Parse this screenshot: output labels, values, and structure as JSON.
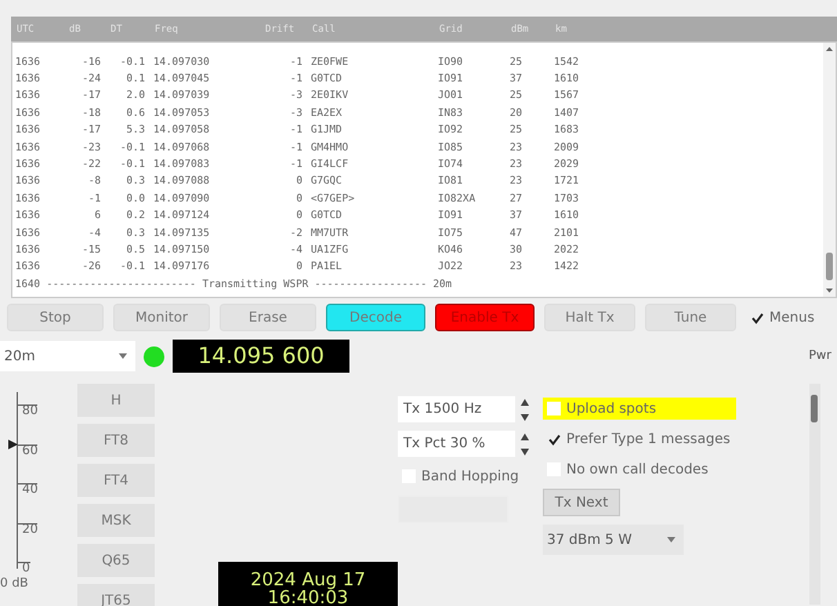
{
  "decodes": {
    "columns": [
      "UTC",
      "dB",
      "DT",
      "Freq",
      "Drift",
      "Call",
      "Grid",
      "dBm",
      "km"
    ],
    "rows": [
      [
        "1636",
        "-16",
        "-0.1",
        "14.097030",
        "-1",
        "ZE0FWE",
        "IO90",
        "25",
        "1542"
      ],
      [
        "1636",
        "-24",
        "0.1",
        "14.097045",
        "-1",
        "G0TCD",
        "IO91",
        "37",
        "1610"
      ],
      [
        "1636",
        "-17",
        "2.0",
        "14.097039",
        "-3",
        "2E0IKV",
        "JO01",
        "25",
        "1567"
      ],
      [
        "1636",
        "-18",
        "0.6",
        "14.097053",
        "-3",
        "EA2EX",
        "IN83",
        "20",
        "1407"
      ],
      [
        "1636",
        "-17",
        "5.3",
        "14.097058",
        "-1",
        "G1JMD",
        "IO92",
        "25",
        "1683"
      ],
      [
        "1636",
        "-23",
        "-0.1",
        "14.097068",
        "-1",
        "GM4HMO",
        "IO85",
        "23",
        "2009"
      ],
      [
        "1636",
        "-22",
        "-0.1",
        "14.097083",
        "-1",
        "GI4LCF",
        "IO74",
        "23",
        "2029"
      ],
      [
        "1636",
        "-8",
        "0.3",
        "14.097088",
        "0",
        "G7GQC",
        "IO81",
        "23",
        "1721"
      ],
      [
        "1636",
        "-1",
        "0.0",
        "14.097090",
        "0",
        "<G7GEP>",
        "IO82XA",
        "27",
        "1703"
      ],
      [
        "1636",
        "6",
        "0.2",
        "14.097124",
        "0",
        "G0TCD",
        "IO91",
        "37",
        "1610"
      ],
      [
        "1636",
        "-4",
        "0.3",
        "14.097135",
        "-2",
        "MM7UTR",
        "IO75",
        "47",
        "2101"
      ],
      [
        "1636",
        "-15",
        "0.5",
        "14.097150",
        "-4",
        "UA1ZFG",
        "KO46",
        "30",
        "2022"
      ],
      [
        "1636",
        "-26",
        "-0.1",
        "14.097176",
        "0",
        "PA1EL",
        "JO22",
        "23",
        "1422"
      ]
    ],
    "separator": "1640 ------------------------ Transmitting WSPR ------------------ 20m"
  },
  "buttons": [
    {
      "label": "Stop",
      "kind": "plain"
    },
    {
      "label": "Monitor",
      "kind": "plain"
    },
    {
      "label": "Erase",
      "kind": "plain"
    },
    {
      "label": "Decode",
      "kind": "cyan"
    },
    {
      "label": "Enable Tx",
      "kind": "red"
    },
    {
      "label": "Halt Tx",
      "kind": "plain"
    },
    {
      "label": "Tune",
      "kind": "plain"
    }
  ],
  "menus": {
    "label": "Menus",
    "checked": true
  },
  "band": {
    "value": "20m"
  },
  "frequency": "14.095 600",
  "pwr_label": "Pwr",
  "pwr_slider": {
    "level": 0.95
  },
  "meter": {
    "ticks": [
      "80",
      "60",
      "40",
      "20",
      "0"
    ],
    "level": 0.7,
    "reading": "0 dB"
  },
  "modes": [
    "H",
    "FT8",
    "FT4",
    "MSK",
    "Q65",
    "JT65"
  ],
  "datetime": {
    "date": "2024 Aug 17",
    "time": "16:40:03"
  },
  "tx_freq": "Tx 1500 Hz",
  "tx_pct": "Tx Pct 30 %",
  "band_hopping": {
    "label": "Band Hopping",
    "checked": false
  },
  "schedule": {
    "disabled": true
  },
  "options": [
    {
      "label": "Upload spots",
      "checked": false,
      "highlighted": true
    },
    {
      "label": "Prefer Type 1 messages",
      "checked": true,
      "highlighted": false
    },
    {
      "label": "No own call decodes",
      "checked": false,
      "highlighted": false
    }
  ],
  "tx_next": "Tx Next",
  "power": {
    "value": "37 dBm  5 W"
  }
}
